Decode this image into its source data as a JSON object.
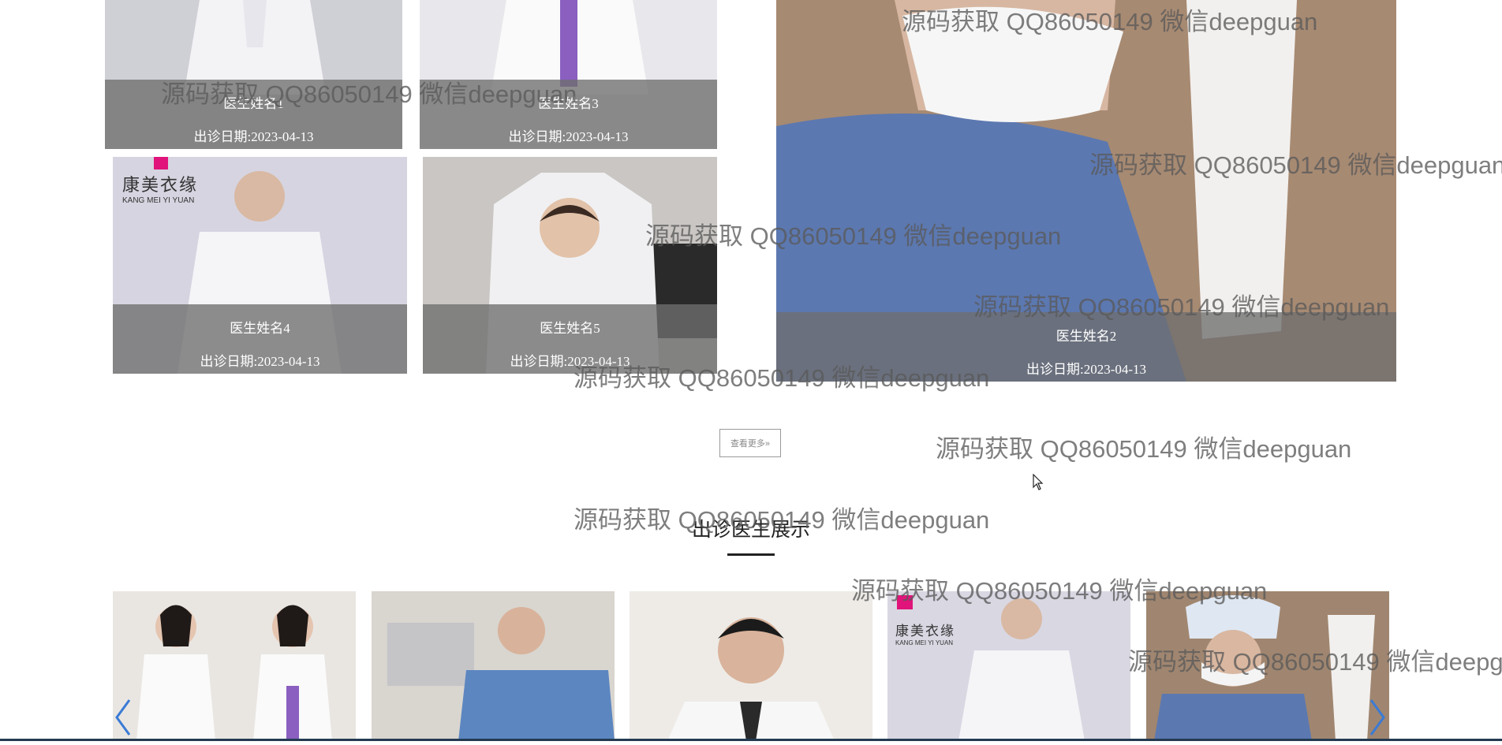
{
  "featured_doctors": [
    {
      "name": "医生姓名1",
      "date": "出诊日期:2023-04-13"
    },
    {
      "name": "医生姓名3",
      "date": "出诊日期:2023-04-13"
    },
    {
      "name": "医生姓名4",
      "date": "出诊日期:2023-04-13",
      "brand": "康美衣缘",
      "brand_en": "KANG MEI YI YUAN"
    },
    {
      "name": "医生姓名5",
      "date": "出诊日期:2023-04-13"
    },
    {
      "name": "医生姓名2",
      "date": "出诊日期:2023-04-13"
    }
  ],
  "more_button": {
    "label": "查看更多»"
  },
  "section": {
    "title": "出诊医生展示"
  },
  "carousel": {
    "brand": "康美衣缘",
    "brand_en": "KANG MEI YI YUAN",
    "prev_icon": "chevron-left-icon",
    "next_icon": "chevron-right-icon"
  },
  "watermark": {
    "text": "源码获取 QQ86050149 微信deepguan"
  },
  "colors": {
    "caption_overlay": "#6e6e6e",
    "arrow": "#3a7bd5",
    "bottom_bar": "#233a52"
  }
}
